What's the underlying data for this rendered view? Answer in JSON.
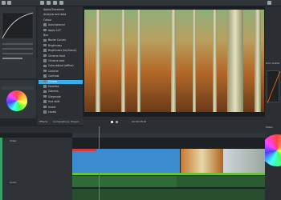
{
  "effects_panel": {
    "items": [
      {
        "label": "Alpha/Transform",
        "cat": true
      },
      {
        "label": "Analysis and data",
        "cat": true
      },
      {
        "label": "Colour",
        "cat": true
      },
      {
        "label": "Auto balance",
        "cat": false
      },
      {
        "label": "Apply LUT",
        "cat": false
      },
      {
        "label": "Blur",
        "cat": true
      },
      {
        "label": "Bezier Curves",
        "cat": false
      },
      {
        "label": "Brightness",
        "cat": false
      },
      {
        "label": "Brightness (keyframe)",
        "cat": false
      },
      {
        "label": "Chroma Hold",
        "cat": false
      },
      {
        "label": "Chroma hold",
        "cat": false
      },
      {
        "label": "Color-adjust (affine)",
        "cat": false
      },
      {
        "label": "Colorize",
        "cat": false
      },
      {
        "label": "Contrast",
        "cat": false
      },
      {
        "label": "Curves",
        "cat": false,
        "selected": true
      },
      {
        "label": "Equalise",
        "cat": false
      },
      {
        "label": "Gamma",
        "cat": false
      },
      {
        "label": "Greyscale",
        "cat": false
      },
      {
        "label": "Hue shift",
        "cat": false
      },
      {
        "label": "Invert",
        "cat": false
      },
      {
        "label": "Levels",
        "cat": false
      }
    ]
  },
  "tabs": [
    "Effects",
    "Compositions",
    "Project"
  ],
  "monitor_timecode": "00:00:05:22",
  "right_panel": {
    "label1": "Point modifier",
    "label2": "Flatten"
  },
  "timeline_headers": [
    "Video",
    "Audio"
  ],
  "colors": {
    "accent": "#3daee9",
    "clip_video": "#3a8ccf",
    "clip_audio": "#2f6b3a"
  }
}
